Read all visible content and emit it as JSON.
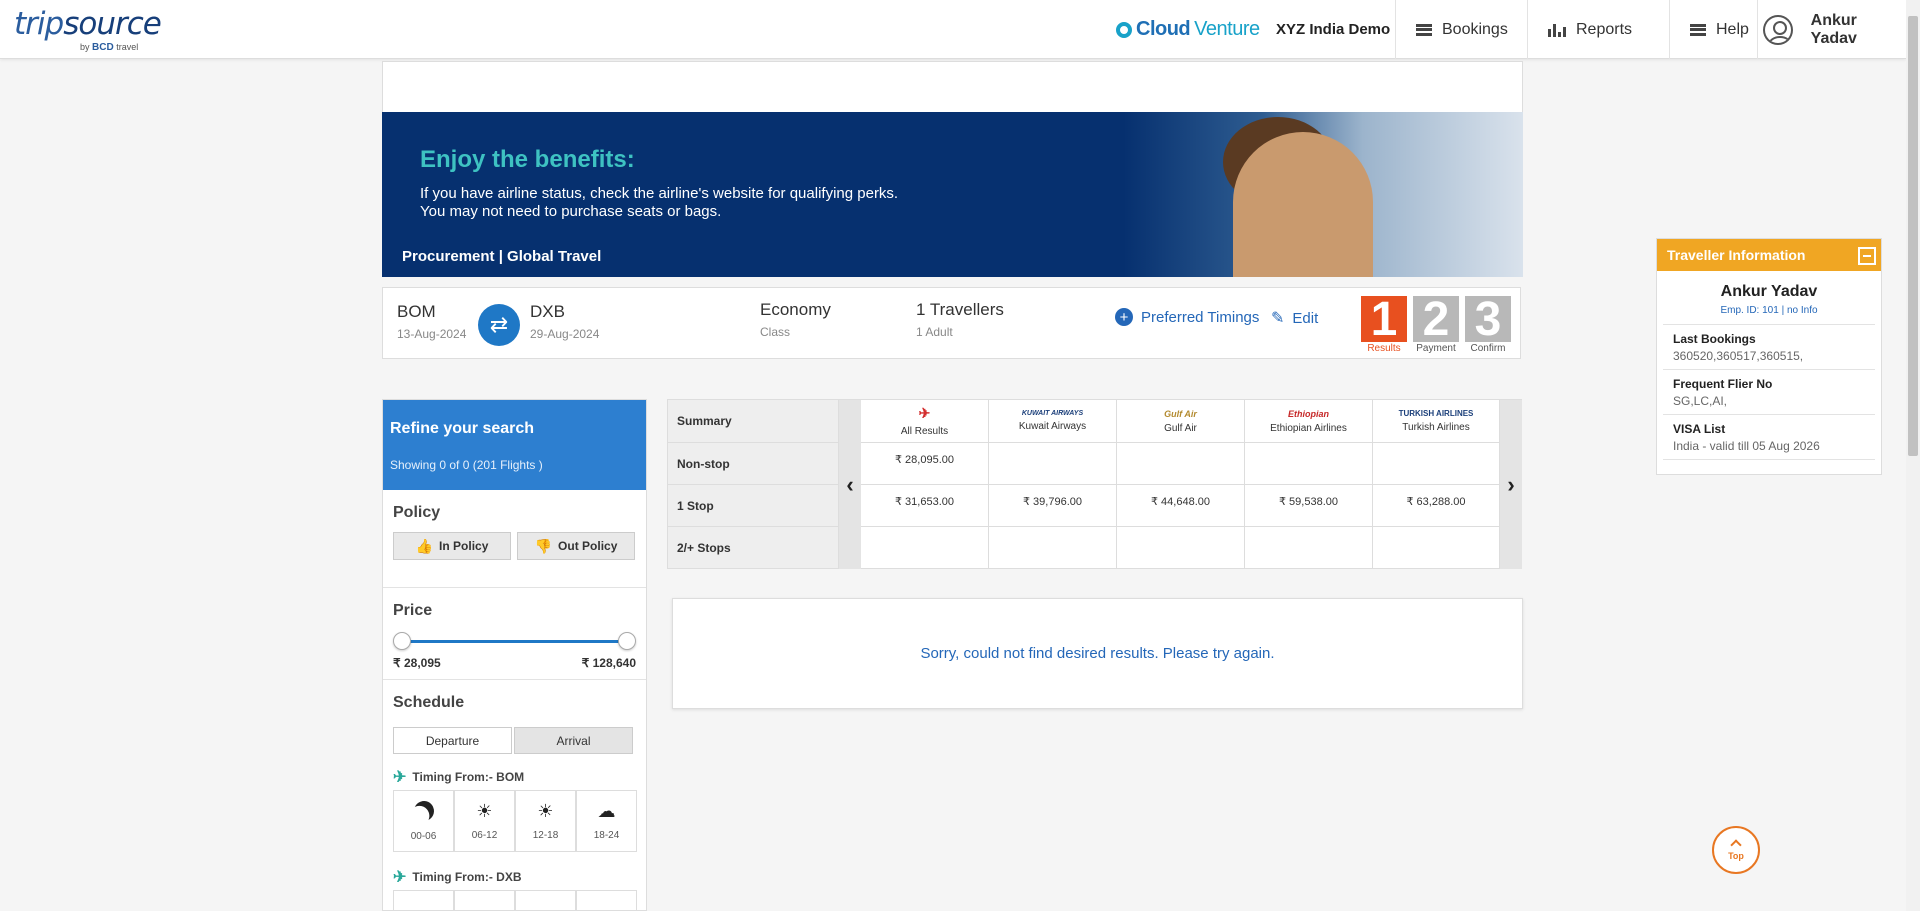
{
  "header": {
    "logo_main": "trip",
    "logo_main2": "source",
    "logo_sub_by": "by",
    "logo_sub_brand": "BCD",
    "logo_sub_travel": "travel",
    "partner_cloud": "Cloud",
    "partner_venture": "Venture",
    "company": "XYZ India Demo",
    "nav": {
      "bookings": "Bookings",
      "reports": "Reports",
      "help": "Help"
    },
    "user": "Ankur Yadav"
  },
  "banner": {
    "title": "Enjoy the benefits:",
    "line1": "If you have airline status, check the airline's website for qualifying perks.",
    "line2": "You may not need to purchase seats or bags.",
    "footer": "Procurement | Global Travel"
  },
  "search": {
    "origin": "BOM",
    "origin_date": "13-Aug-2024",
    "destination": "DXB",
    "destination_date": "29-Aug-2024",
    "class_value": "Economy",
    "class_label": "Class",
    "travellers_value": "1 Travellers",
    "travellers_detail": "1 Adult",
    "preferred_timings": "Preferred Timings",
    "edit": "Edit",
    "steps": [
      {
        "num": "1",
        "label": "Results",
        "color": "#e8501f"
      },
      {
        "num": "2",
        "label": "Payment",
        "color": "#b8b8b8"
      },
      {
        "num": "3",
        "label": "Confirm",
        "color": "#b8b8b8"
      }
    ]
  },
  "refine": {
    "title": "Refine your search",
    "showing": "Showing 0 of 0 (201 Flights )",
    "policy_title": "Policy",
    "in_policy": "In Policy",
    "out_policy": "Out Policy",
    "price_title": "Price",
    "price_min": "₹ 28,095",
    "price_max": "₹ 128,640",
    "schedule_title": "Schedule",
    "departure": "Departure",
    "arrival": "Arrival",
    "timing_from_1": "Timing From:- BOM",
    "timing_from_2": "Timing From:- DXB",
    "slots": [
      "00-06",
      "06-12",
      "12-18",
      "18-24"
    ]
  },
  "matrix": {
    "summary": "Summary",
    "rows": [
      "Non-stop",
      "1 Stop",
      "2/+ Stops"
    ],
    "airlines": [
      {
        "name": "All Results",
        "logo": "✈",
        "color": "#d32f2f"
      },
      {
        "name": "Kuwait Airways",
        "logo": "KUWAIT AIRWAYS",
        "color": "#1b3f7a"
      },
      {
        "name": "Gulf Air",
        "logo": "Gulf Air",
        "color": "#b38a2e"
      },
      {
        "name": "Ethiopian Airlines",
        "logo": "Ethiopian",
        "color": "#c62828"
      },
      {
        "name": "Turkish Airlines",
        "logo": "TURKISH AIRLINES",
        "color": "#c62828"
      }
    ],
    "prices": [
      [
        "₹ 28,095.00",
        "",
        "",
        "",
        ""
      ],
      [
        "₹ 31,653.00",
        "₹ 39,796.00",
        "₹ 44,648.00",
        "₹ 59,538.00",
        "₹ 63,288.00"
      ],
      [
        "",
        "",
        "",
        "",
        ""
      ]
    ]
  },
  "no_results": "Sorry, could not find desired results. Please try again.",
  "traveller": {
    "title": "Traveller Information",
    "name": "Ankur Yadav",
    "emp_id": "Emp. ID: 101 | no Info",
    "last_bookings_label": "Last Bookings",
    "last_bookings": "360520,360517,360515,",
    "ffn_label": "Frequent Flier No",
    "ffn": "SG,LC,AI,",
    "visa_label": "VISA List",
    "visa": "India - valid till 05 Aug 2026"
  },
  "top_button": "Top"
}
